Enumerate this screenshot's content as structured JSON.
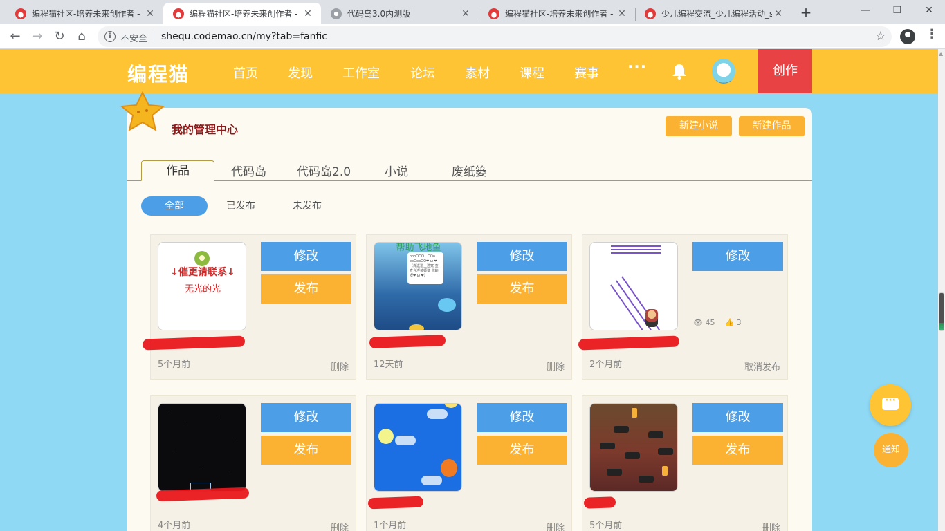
{
  "browser": {
    "tabs": [
      {
        "title": "编程猫社区-培养未来创作者 -",
        "icon": "codemao-cat-icon",
        "active": false
      },
      {
        "title": "编程猫社区-培养未来创作者 -",
        "icon": "codemao-cat-icon",
        "active": true
      },
      {
        "title": "代码岛3.0内测版",
        "icon": "gear-icon",
        "active": false
      },
      {
        "title": "编程猫社区-培养未来创作者 -",
        "icon": "codemao-cat-icon",
        "active": false
      },
      {
        "title": "少儿编程交流_少儿编程活动_s",
        "icon": "codemao-cat-icon",
        "active": false
      }
    ],
    "close_glyph": "✕",
    "new_tab_glyph": "+",
    "window_controls": {
      "minimize": "—",
      "maximize": "❐",
      "close": "✕"
    },
    "address": {
      "security_label": "不安全",
      "url": "shequ.codemao.cn/my?tab=fanfic"
    }
  },
  "site": {
    "logo": "编程猫",
    "nav": [
      "首页",
      "发现",
      "工作室",
      "论坛",
      "素材",
      "课程",
      "赛事"
    ],
    "more": "···",
    "create": "创作"
  },
  "panel": {
    "title": "我的管理中心",
    "new_novel": "新建小说",
    "new_work": "新建作品",
    "tabs": [
      "作品",
      "代码岛",
      "代码岛2.0",
      "小说",
      "废纸篓"
    ],
    "active_tab": "作品",
    "filters": [
      "全部",
      "已发布",
      "未发布"
    ],
    "active_filter": "全部"
  },
  "works": [
    {
      "thumb_lines": [
        "↓催更请联系↓",
        "无光的光"
      ],
      "edit": "修改",
      "publish": "发布",
      "time": "5个月前",
      "action": "删除"
    },
    {
      "thumb_caption": "帮助飞地鱼",
      "thumb_note": "oooOOO、OOo ooOooOO❤ ω ❤（传送道上选究 查查合浮黄频黎 你的呀❤ ω ❤）",
      "edit": "修改",
      "publish": "发布",
      "time": "12天前",
      "action": "删除"
    },
    {
      "edit": "修改",
      "views": "45",
      "likes": "3",
      "time": "2个月前",
      "action": "取消发布"
    },
    {
      "edit": "修改",
      "publish": "发布",
      "time": "4个月前",
      "action": "删除"
    },
    {
      "edit": "修改",
      "publish": "发布",
      "time": "1个月前",
      "action": "删除"
    },
    {
      "edit": "修改",
      "publish": "发布",
      "time": "5个月前",
      "action": "删除"
    }
  ],
  "floating": {
    "notice": "通知"
  },
  "colors": {
    "brand_yellow": "#fec433",
    "create_red": "#e94244",
    "edit_blue": "#4c9fe6",
    "publish_orange": "#fbb233",
    "page_bg": "#8fd9f5"
  }
}
